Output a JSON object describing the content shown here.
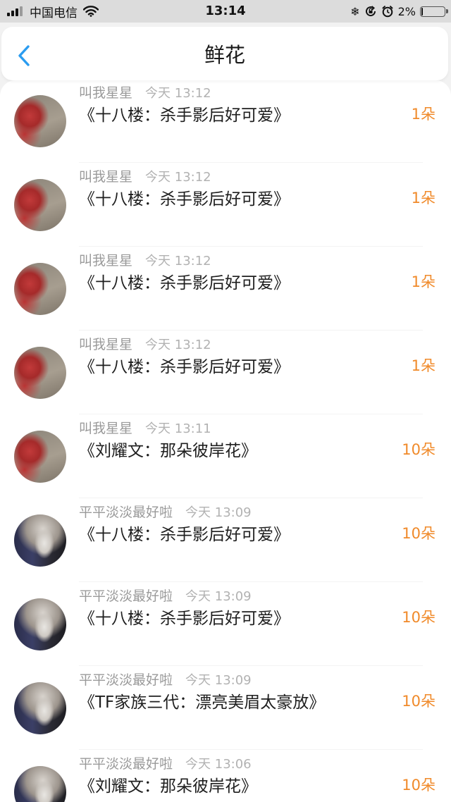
{
  "status_bar": {
    "carrier": "中国电信",
    "time": "13:14",
    "battery_percent": "2%",
    "battery_level": 0.02,
    "icons": [
      "signal-icon",
      "wifi-icon",
      "snowflake-icon",
      "rotation-lock-icon",
      "alarm-icon",
      "battery-icon"
    ]
  },
  "nav": {
    "title": "鲜花",
    "back_icon": "chevron-left-icon",
    "accent_color": "#2a9cf0"
  },
  "colors": {
    "count": "#f08a2a",
    "name": "#9a9a9a",
    "title": "#1e1e1e"
  },
  "list": {
    "items": [
      {
        "name": "叫我星星",
        "time": "今天 13:12",
        "title": "《十八楼：杀手影后好可爱》",
        "count": "1朵",
        "avatar": "red"
      },
      {
        "name": "叫我星星",
        "time": "今天 13:12",
        "title": "《十八楼：杀手影后好可爱》",
        "count": "1朵",
        "avatar": "red"
      },
      {
        "name": "叫我星星",
        "time": "今天 13:12",
        "title": "《十八楼：杀手影后好可爱》",
        "count": "1朵",
        "avatar": "red"
      },
      {
        "name": "叫我星星",
        "time": "今天 13:12",
        "title": "《十八楼：杀手影后好可爱》",
        "count": "1朵",
        "avatar": "red"
      },
      {
        "name": "叫我星星",
        "time": "今天 13:11",
        "title": "《刘耀文：那朵彼岸花》",
        "count": "10朵",
        "avatar": "red"
      },
      {
        "name": "平平淡淡最好啦",
        "time": "今天 13:09",
        "title": "《十八楼：杀手影后好可爱》",
        "count": "10朵",
        "avatar": "dark"
      },
      {
        "name": "平平淡淡最好啦",
        "time": "今天 13:09",
        "title": "《十八楼：杀手影后好可爱》",
        "count": "10朵",
        "avatar": "dark"
      },
      {
        "name": "平平淡淡最好啦",
        "time": "今天 13:09",
        "title": "《TF家族三代：漂亮美眉太豪放》",
        "count": "10朵",
        "avatar": "dark"
      },
      {
        "name": "平平淡淡最好啦",
        "time": "今天 13:06",
        "title": "《刘耀文：那朵彼岸花》",
        "count": "10朵",
        "avatar": "dark"
      }
    ]
  }
}
